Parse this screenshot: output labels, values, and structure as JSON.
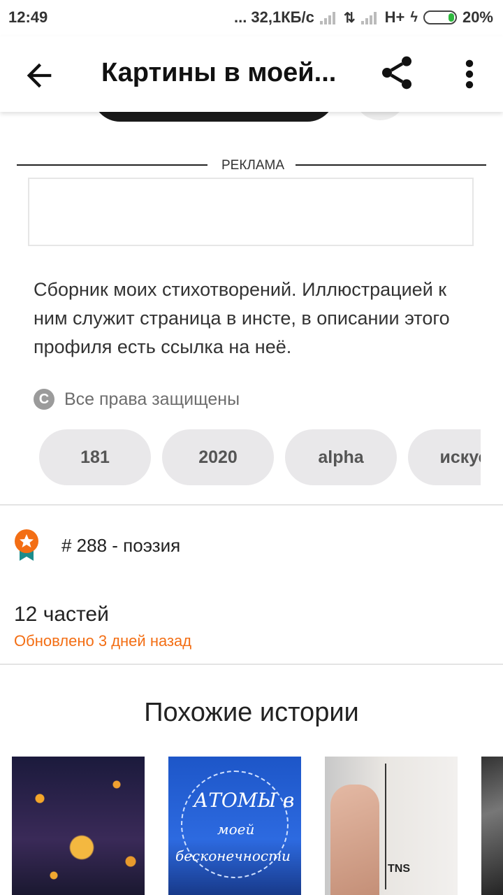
{
  "status_bar": {
    "time": "12:49",
    "network_speed": "... 32,1КБ/с",
    "network_type": "H+",
    "battery": "20%",
    "battery_level": 0.2,
    "battery_color": "#2db83d"
  },
  "app_bar": {
    "title": "Картины в моей...",
    "icons": [
      "arrow-back-icon",
      "share-icon",
      "more-vert-icon"
    ]
  },
  "ad": {
    "label": "РЕКЛАМА"
  },
  "story": {
    "description": "Сборник моих стихотворений. Иллюстрацией к ним служит страница в инсте, в описании этого профиля есть ссылка на неё.",
    "copyright": "Все права защищены",
    "tags": [
      "181",
      "2020",
      "alpha",
      "искус"
    ],
    "rank": "# 288 - поэзия",
    "parts": "12 частей",
    "updated": "Обновлено 3 дней назад"
  },
  "similar": {
    "title": "Похожие истории",
    "cover2_text": [
      "АТОМЫ в",
      "моей",
      "бесконечности"
    ],
    "cover3_text": "TNS"
  },
  "colors": {
    "accent": "#f36e14",
    "tag_bg": "#e9e8ea",
    "text": "#222222"
  }
}
